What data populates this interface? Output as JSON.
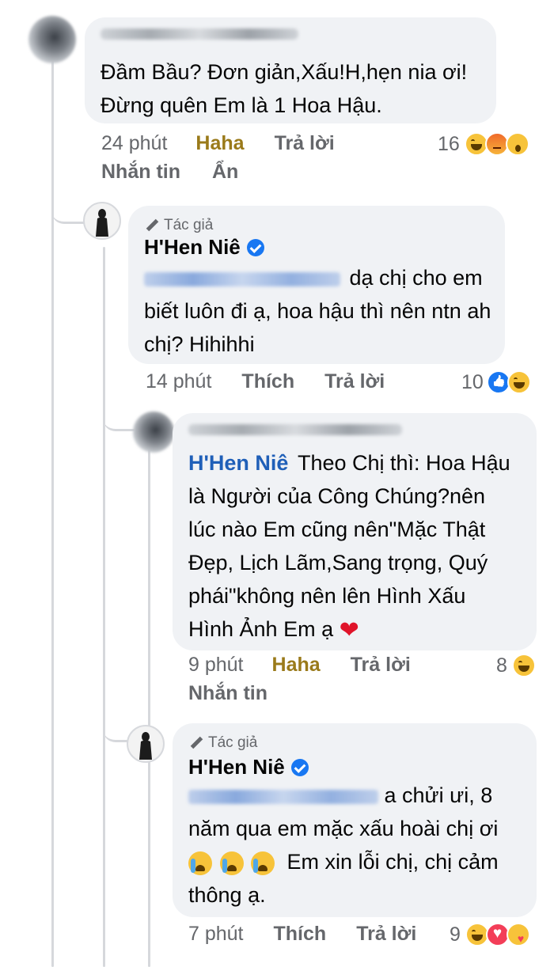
{
  "comments": [
    {
      "text_lines": [
        "Đầm Bầu? Đơn giản,Xấu!H,hẹn nia ơi!",
        "Đừng quên Em là 1 Hoa Hậu."
      ],
      "time": "24 phút",
      "reaction_label": "Haha",
      "reply_label": "Trả lời",
      "extra_actions": [
        "Nhắn tin",
        "Ẩn"
      ],
      "reaction_count": "16",
      "reaction_icons": [
        "haha-icon",
        "angry-icon",
        "wow-icon"
      ]
    },
    {
      "author_badge": "Tác giả",
      "author_name": "H'Hen Niê",
      "text_after_mention": "dạ chị cho em",
      "text_lines": [
        "biết luôn đi ạ, hoa hậu thì nên ntn ah",
        "chị? Hihihhi"
      ],
      "time": "14 phút",
      "reaction_label": "Thích",
      "reply_label": "Trả lời",
      "reaction_count": "10",
      "reaction_icons": [
        "like-icon",
        "haha-icon"
      ]
    },
    {
      "mention": "H'Hen Niê",
      "text_first": "Theo Chị thì: Hoa Hậu",
      "text_lines": [
        "là Người của Công Chúng?nên",
        "lúc nào Em cũng nên\"Mặc Thật",
        "Đẹp, Lịch Lãm,Sang trọng, Quý",
        "phái\"không nên lên Hình Xấu",
        "Hình Ảnh Em ạ"
      ],
      "time": "9 phút",
      "reaction_label": "Haha",
      "reply_label": "Trả lời",
      "extra_actions": [
        "Nhắn tin"
      ],
      "reaction_count": "8",
      "reaction_icons": [
        "haha-icon"
      ]
    },
    {
      "author_badge": "Tác giả",
      "author_name": "H'Hen Niê",
      "text_after_mention": "a chửi ưi, 8",
      "text_lines": [
        "năm qua em mặc xấu hoài chị ơi"
      ],
      "text_after_emoji": "Em xin lỗi chị, chị cảm",
      "text_last": "thông ạ.",
      "time": "7 phút",
      "reaction_label": "Thích",
      "reply_label": "Trả lời",
      "reaction_count": "9",
      "reaction_icons": [
        "haha-icon",
        "love-icon",
        "care-icon"
      ]
    }
  ]
}
